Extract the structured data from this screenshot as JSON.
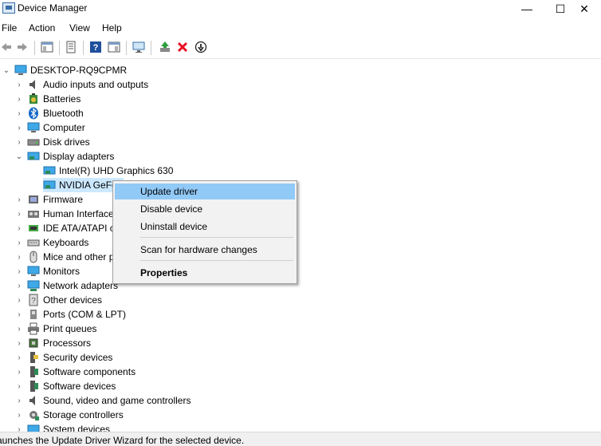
{
  "window": {
    "title": "Device Manager",
    "minimize_glyph": "—",
    "maximize_glyph": "☐",
    "close_glyph": "✕"
  },
  "menu": {
    "items": [
      "File",
      "Action",
      "View",
      "Help"
    ]
  },
  "toolbar": {
    "icons": [
      "back-icon",
      "forward-icon",
      "show-hide-console-tree-icon",
      "properties-icon",
      "help-icon",
      "action-pane-icon",
      "monitor-icon",
      "update-driver-icon",
      "uninstall-icon",
      "disable-icon"
    ]
  },
  "tree": {
    "root": "DESKTOP-RQ9CPMR",
    "categories": [
      {
        "label": "Audio inputs and outputs",
        "icon": "speaker-icon"
      },
      {
        "label": "Batteries",
        "icon": "battery-icon"
      },
      {
        "label": "Bluetooth",
        "icon": "bluetooth-icon"
      },
      {
        "label": "Computer",
        "icon": "computer-icon"
      },
      {
        "label": "Disk drives",
        "icon": "disk-drive-icon"
      },
      {
        "label": "Display adapters",
        "icon": "display-adapter-icon",
        "expanded": true,
        "children": [
          "Intel(R) UHD Graphics 630",
          "NVIDIA GeFo"
        ]
      },
      {
        "label": "Firmware",
        "icon": "firmware-icon"
      },
      {
        "label": "Human Interface",
        "icon": "hid-icon"
      },
      {
        "label": "IDE ATA/ATAPI c",
        "icon": "ide-icon"
      },
      {
        "label": "Keyboards",
        "icon": "keyboard-icon"
      },
      {
        "label": "Mice and other p",
        "icon": "mouse-icon"
      },
      {
        "label": "Monitors",
        "icon": "monitor-icon"
      },
      {
        "label": "Network adapters",
        "icon": "network-adapter-icon"
      },
      {
        "label": "Other devices",
        "icon": "other-devices-icon"
      },
      {
        "label": "Ports (COM & LPT)",
        "icon": "port-icon"
      },
      {
        "label": "Print queues",
        "icon": "printer-icon"
      },
      {
        "label": "Processors",
        "icon": "processor-icon"
      },
      {
        "label": "Security devices",
        "icon": "security-device-icon"
      },
      {
        "label": "Software components",
        "icon": "software-component-icon"
      },
      {
        "label": "Software devices",
        "icon": "software-device-icon"
      },
      {
        "label": "Sound, video and game controllers",
        "icon": "sound-icon"
      },
      {
        "label": "Storage controllers",
        "icon": "storage-controller-icon"
      },
      {
        "label": "System devices",
        "icon": "system-device-icon"
      }
    ]
  },
  "context_menu": {
    "items": [
      {
        "label": "Update driver",
        "selected": true
      },
      {
        "label": "Disable device"
      },
      {
        "label": "Uninstall device"
      },
      {
        "label": "Scan for hardware changes"
      },
      {
        "label": "Properties",
        "bold": true
      }
    ]
  },
  "status_bar": {
    "text": "aunches the Update Driver Wizard for the selected device."
  },
  "colors": {
    "selection": "#91c9f7",
    "accent": "#0078d7",
    "uninstall_red": "#e81123",
    "tree_icon_green": "#2e8b57"
  }
}
